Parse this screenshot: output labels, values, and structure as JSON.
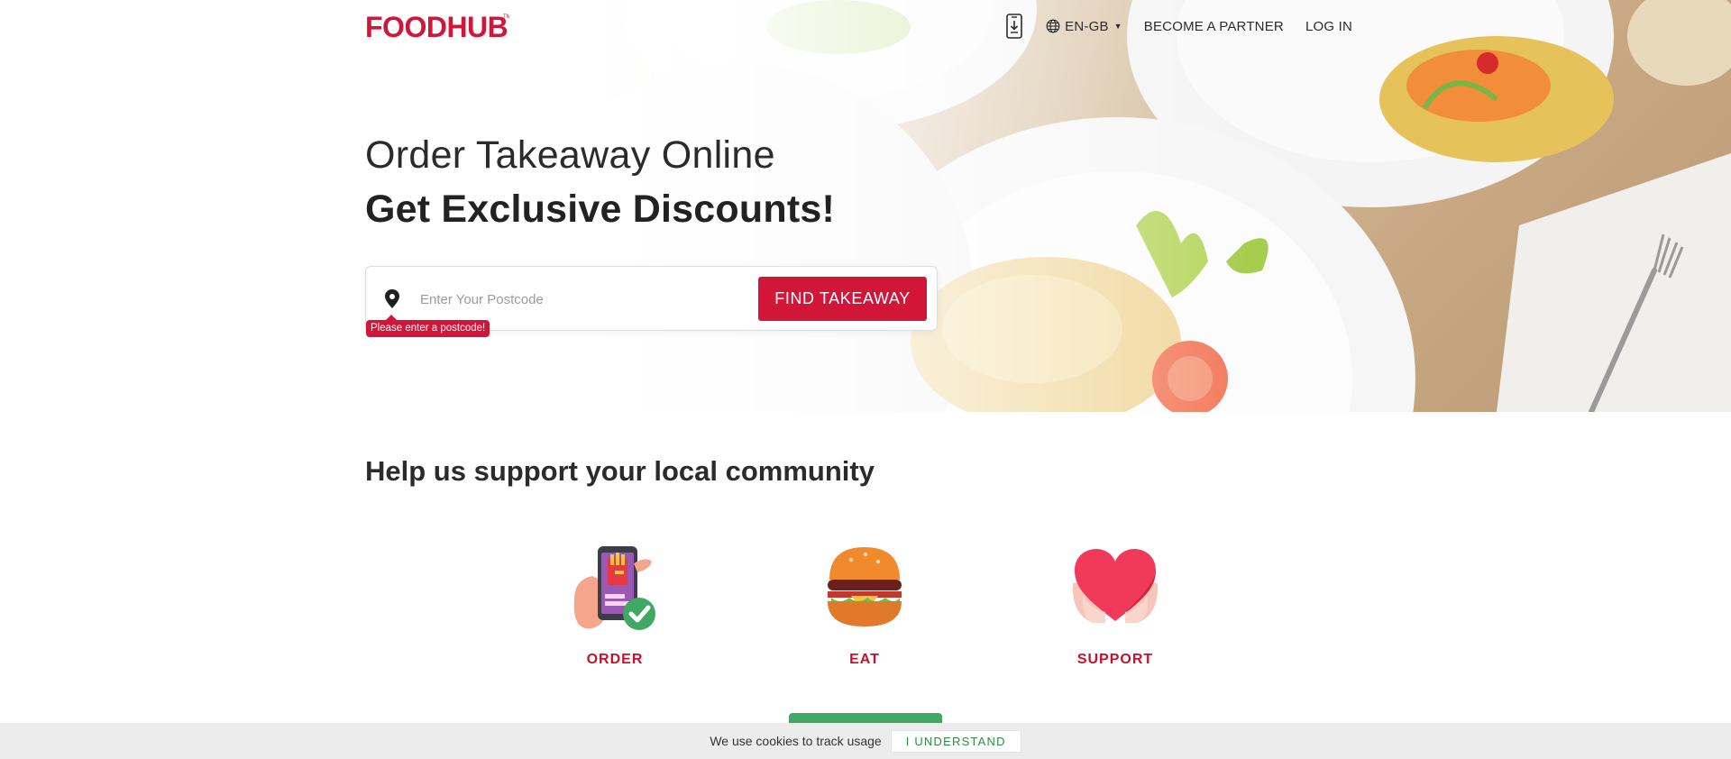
{
  "brand": {
    "logo_text": "FOODHUB",
    "accent_color": "#d1163a"
  },
  "nav": {
    "app_download_icon": "phone-download-icon",
    "language_icon": "globe-icon",
    "language": "EN-GB",
    "become_partner": "BECOME A PARTNER",
    "login": "LOG IN"
  },
  "hero": {
    "headline_line1": "Order Takeaway Online",
    "headline_line2": "Get Exclusive Discounts!"
  },
  "search": {
    "location_icon": "map-pin-icon",
    "placeholder": "Enter Your Postcode",
    "value": "",
    "button_label": "FIND TAKEAWAY",
    "error_message": "Please enter a postcode!"
  },
  "community": {
    "title": "Help us support your local community",
    "features": [
      {
        "label": "ORDER",
        "icon": "phone-order-icon"
      },
      {
        "label": "EAT",
        "icon": "burger-icon"
      },
      {
        "label": "SUPPORT",
        "icon": "heart-hands-icon"
      }
    ]
  },
  "cookie": {
    "message": "We use cookies to track usage",
    "button_label": "I UNDERSTAND"
  }
}
